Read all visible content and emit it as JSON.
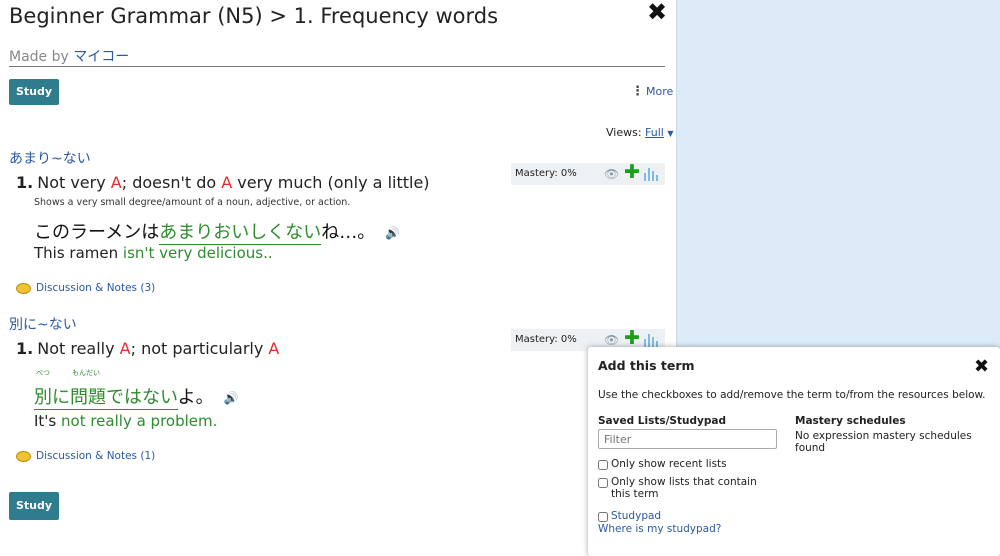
{
  "header": {
    "title": "Beginner Grammar (N5) > 1. Frequency words",
    "close_glyph": "✖",
    "made_by_label": "Made by",
    "author": "マイコー"
  },
  "toolbar": {
    "study_label": "Study",
    "more_label": "More",
    "views_label": "Views:",
    "views_value": "Full"
  },
  "entries": [
    {
      "term": "あまり~ない",
      "number": "1.",
      "sense_parts": [
        "Not very ",
        "A",
        "; doesn't do ",
        "A",
        " very much (only a little)"
      ],
      "description": "Shows a very small degree/amount of a noun, adjective, or action.",
      "jp_before": "このラーメンは",
      "jp_highlight": "あまりおいしくない",
      "jp_after": "ね…。",
      "furigana": [],
      "en_before": "This ramen ",
      "en_highlight": "isn't very delicious..",
      "discussion": "Discussion & Notes (3)",
      "mastery": "Mastery: 0%"
    },
    {
      "term": "別に~ない",
      "number": "1.",
      "sense_parts": [
        "Not really ",
        "A",
        "; not particularly ",
        "A"
      ],
      "description": "",
      "jp_before": "",
      "jp_highlight": "別に問題ではない",
      "jp_after": "よ。",
      "furigana": [
        "べつ",
        "もんだい"
      ],
      "en_before": "It's ",
      "en_highlight": "not really a problem.",
      "discussion": "Discussion & Notes (1)",
      "mastery": "Mastery: 0%"
    }
  ],
  "popup": {
    "title": "Add this term",
    "instructions": "Use the checkboxes to add/remove the term to/from the resources below.",
    "saved_lists_heading": "Saved Lists/Studypad",
    "mastery_heading": "Mastery schedules",
    "filter_placeholder": "Filter",
    "no_schedules": "No expression mastery schedules found",
    "opt_recent": "Only show recent lists",
    "opt_contain": "Only show lists that contain this term",
    "studypad": "Studypad",
    "where_link": "Where is my studypad?"
  },
  "colors": {
    "accent_button": "#2f7c8e",
    "link": "#2a5aa0",
    "highlight_green": "#2e8b2e",
    "placeholder_red": "#e52b2b"
  },
  "icons": [
    "close-icon",
    "more-dots-icon",
    "eye-icon",
    "plus-icon",
    "stats-icon",
    "speaker-icon",
    "speech-bubble-icon"
  ]
}
